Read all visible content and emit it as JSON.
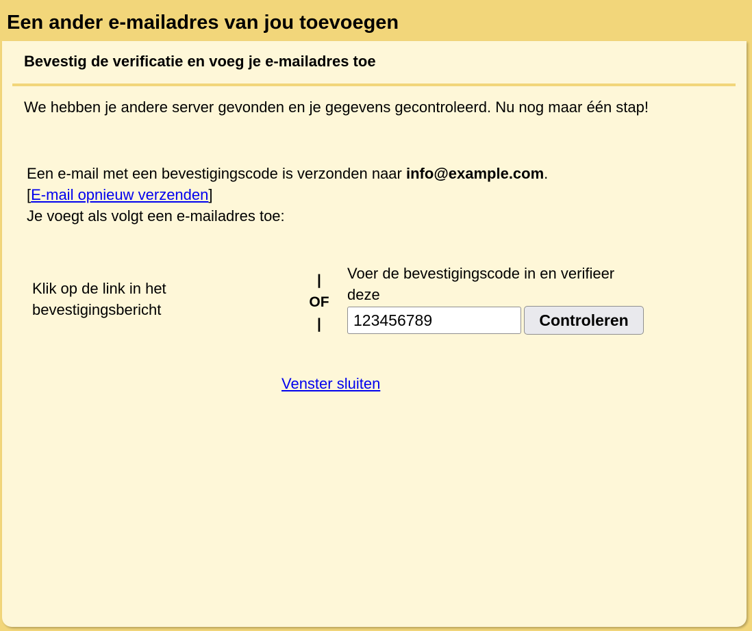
{
  "dialog": {
    "title": "Een ander e-mailadres van jou toevoegen",
    "subtitle": "Bevestig de verificatie en voeg je e-mailadres toe",
    "intro": "We hebben je andere server gevonden en je gegevens gecontroleerd. Nu nog maar één stap!",
    "sent_prefix": "Een e-mail met een bevestigingscode is verzonden naar ",
    "email": "info@example.com",
    "sent_suffix": ".",
    "resend_open_bracket": "[",
    "resend_link": "E-mail opnieuw verzenden",
    "resend_close_bracket": "]",
    "instruction": "Je voegt als volgt een e-mailadres toe:",
    "option_link_text": "Klik op de link in het bevestigingsbericht",
    "or_bar_top": "|",
    "or_label": "OF",
    "or_bar_bottom": "|",
    "option_code_text": "Voer de bevestigingscode in en verifieer deze",
    "code_input_value": "123456789",
    "verify_button": "Controleren",
    "close_link": "Venster sluiten"
  },
  "colors": {
    "title_bar": "#f2d67a",
    "panel_background": "#fef7d8",
    "link": "#0000ee",
    "button_background": "#e9e9ed"
  }
}
